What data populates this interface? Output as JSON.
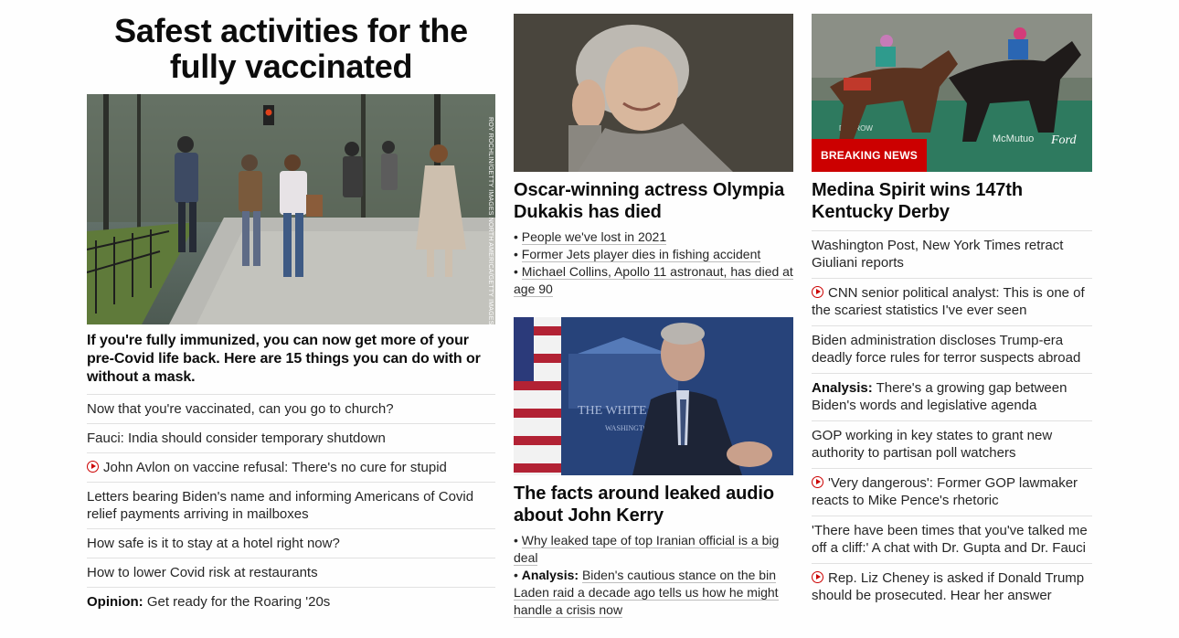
{
  "col1": {
    "title": "Safest activities for the fully vaccinated",
    "hero_credit": "ROY ROCHLIN/GETTY IMAGES NORTH AMERICA/GETTY IMAGES",
    "lede": "If you're fully immunized, you can now get more of your pre-Covid life back. Here are 15 things you can do with or without a mask.",
    "links": [
      {
        "label": "",
        "text": "Now that you're vaccinated, can you go to church?",
        "video": false
      },
      {
        "label": "",
        "text": "Fauci: India should consider temporary shutdown",
        "video": false
      },
      {
        "label": "",
        "text": "John Avlon on vaccine refusal: There's no cure for stupid",
        "video": true
      },
      {
        "label": "",
        "text": "Letters bearing Biden's name and informing Americans of Covid relief payments arriving in mailboxes",
        "video": false
      },
      {
        "label": "",
        "text": "How safe is it to stay at a hotel right now?",
        "video": false
      },
      {
        "label": "",
        "text": "How to lower Covid risk at restaurants",
        "video": false
      },
      {
        "label": "Opinion:",
        "text": "Get ready for the Roaring '20s",
        "video": false
      }
    ]
  },
  "col2": {
    "story1": {
      "headline": "Oscar-winning actress Olympia Dukakis has died",
      "bullets": [
        {
          "label": "",
          "text": "People we've lost in 2021"
        },
        {
          "label": "",
          "text": "Former Jets player dies in fishing accident"
        },
        {
          "label": "",
          "text": "Michael Collins, Apollo 11 astronaut, has died at age 90"
        }
      ]
    },
    "story2": {
      "image_text": "THE WHITE",
      "image_subtext": "WASHINGTON",
      "headline": "The facts around leaked audio about John Kerry",
      "bullets": [
        {
          "label": "",
          "text": "Why leaked tape of top Iranian official is a big deal"
        },
        {
          "label": "Analysis:",
          "text": "Biden's cautious stance on the bin Laden raid a decade ago tells us how he might handle a crisis now"
        }
      ]
    }
  },
  "col3": {
    "badge": "BREAKING NEWS",
    "image_signs": {
      "sign1": "DOBROW",
      "sign2": "McMutuo",
      "sign3": "Ford"
    },
    "headline": "Medina Spirit wins 147th Kentucky Derby",
    "links": [
      {
        "label": "",
        "text": "Washington Post, New York Times retract Giuliani reports",
        "video": false
      },
      {
        "label": "",
        "text": "CNN senior political analyst: This is one of the scariest statistics I've ever seen",
        "video": true
      },
      {
        "label": "",
        "text": "Biden administration discloses Trump-era deadly force rules for terror suspects abroad",
        "video": false
      },
      {
        "label": "Analysis:",
        "text": "There's a growing gap between Biden's words and legislative agenda",
        "video": false
      },
      {
        "label": "",
        "text": "GOP working in key states to grant new authority to partisan poll watchers",
        "video": false
      },
      {
        "label": "",
        "text": "'Very dangerous': Former GOP lawmaker reacts to Mike Pence's rhetoric",
        "video": true
      },
      {
        "label": "",
        "text": "'There have been times that you've talked me off a cliff:' A chat with Dr. Gupta and Dr. Fauci",
        "video": false
      },
      {
        "label": "",
        "text": "Rep. Liz Cheney is asked if Donald Trump should be prosecuted. Hear her answer",
        "video": true
      }
    ]
  },
  "colors": {
    "accent": "#cc0000",
    "text": "#0c0c0c",
    "divider": "#e1e1e1"
  },
  "icons": {
    "video": "play-circle-icon"
  }
}
